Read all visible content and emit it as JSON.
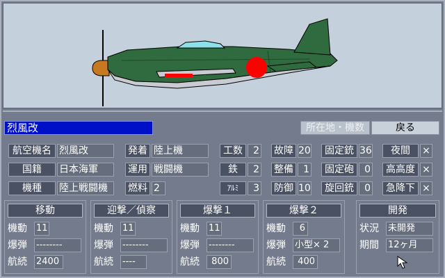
{
  "aircraft_name": "烈風改",
  "tabs": {
    "location": "所在地・機数",
    "back": "戻る"
  },
  "specs": {
    "name_label": "航空機名",
    "name_value": "烈風改",
    "nation_label": "国籍",
    "nation_value": "日本海軍",
    "type_label": "機種",
    "type_value": "陸上戦闘機",
    "launch_label": "発着",
    "launch_value": "陸上機",
    "role_label": "運用",
    "role_value": "戦闘機",
    "fuel_label": "燃料",
    "fuel_value": "2",
    "labor_label": "工数",
    "labor_value": "2",
    "iron_label": "鉄",
    "iron_value": "2",
    "alum_label": "ｱﾙﾐ",
    "alum_value": "3",
    "failure_label": "故障",
    "failure_value": "20",
    "maintenance_label": "整備",
    "maintenance_value": "1",
    "defense_label": "防御",
    "defense_value": "10",
    "fixed_gun_label": "固定銃",
    "fixed_gun_value": "36",
    "fixed_cannon_label": "固定砲",
    "fixed_cannon_value": "0",
    "turret_gun_label": "旋回銃",
    "turret_gun_value": "0",
    "night_label": "夜間",
    "night_value": "×",
    "altitude_label": "高高度",
    "altitude_value": "×",
    "dive_label": "急降下",
    "dive_value": "×"
  },
  "panels": [
    {
      "title": "移動",
      "rows": [
        {
          "label": "機動",
          "value": "11"
        },
        {
          "label": "爆弾",
          "value": "--------"
        },
        {
          "label": "航続",
          "value": "2400"
        }
      ]
    },
    {
      "title": "迎撃／偵察",
      "rows": [
        {
          "label": "機動",
          "value": "11"
        },
        {
          "label": "爆弾",
          "value": "--------"
        },
        {
          "label": "航続",
          "value": "----"
        }
      ]
    },
    {
      "title": "爆撃１",
      "rows": [
        {
          "label": "機動",
          "value": "11"
        },
        {
          "label": "爆弾",
          "value": "--------"
        },
        {
          "label": "航続",
          "value": "800"
        }
      ]
    },
    {
      "title": "爆撃２",
      "rows": [
        {
          "label": "機動",
          "value": "6"
        },
        {
          "label": "爆弾",
          "value": "小型× 2"
        },
        {
          "label": "航続",
          "value": "400"
        }
      ]
    }
  ],
  "development": {
    "title": "開発",
    "status_label": "状況",
    "status_value": "未開発",
    "period_label": "期間",
    "period_value": "12ヶ月"
  },
  "colors": {
    "name_box": "#0010c8",
    "panel_bg": "#737b8c",
    "label_bg": "#4a5162",
    "value_bg": "#666e7e",
    "sky": "#c4d0dc",
    "plane_green": "#2f6b3e",
    "hinomaru": "#ff0000"
  }
}
